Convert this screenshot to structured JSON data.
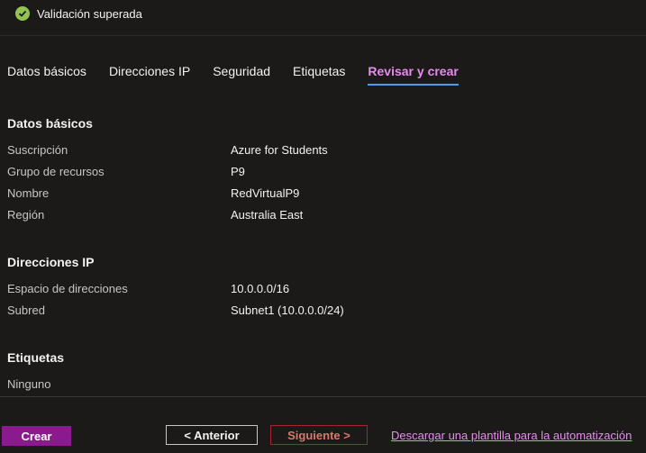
{
  "banner": {
    "text": "Validación superada",
    "icon": "checkmark-circle-icon",
    "icon_color": "#92c353"
  },
  "tabs": [
    {
      "label": "Datos básicos",
      "active": false
    },
    {
      "label": "Direcciones IP",
      "active": false
    },
    {
      "label": "Seguridad",
      "active": false
    },
    {
      "label": "Etiquetas",
      "active": false
    },
    {
      "label": "Revisar y crear",
      "active": true
    }
  ],
  "sections": {
    "basics": {
      "title": "Datos básicos",
      "rows": [
        {
          "label": "Suscripción",
          "value": "Azure for Students"
        },
        {
          "label": "Grupo de recursos",
          "value": "P9"
        },
        {
          "label": "Nombre",
          "value": "RedVirtualP9"
        },
        {
          "label": "Región",
          "value": "Australia East"
        }
      ]
    },
    "ip": {
      "title": "Direcciones IP",
      "rows": [
        {
          "label": "Espacio de direcciones",
          "value": "10.0.0.0/16"
        },
        {
          "label": "Subred",
          "value": "Subnet1 (10.0.0.0/24)"
        }
      ]
    },
    "tags": {
      "title": "Etiquetas",
      "none_text": "Ninguno"
    }
  },
  "footer": {
    "create_label": "Crear",
    "prev_label": "< Anterior",
    "next_label": "Siguiente >",
    "download_link": "Descargar una plantilla para la automatización"
  },
  "colors": {
    "accent": "#e88bf0",
    "tab_underline": "#4f9be8",
    "create_button": "#8c1a8f",
    "next_border": "#a4262c"
  }
}
